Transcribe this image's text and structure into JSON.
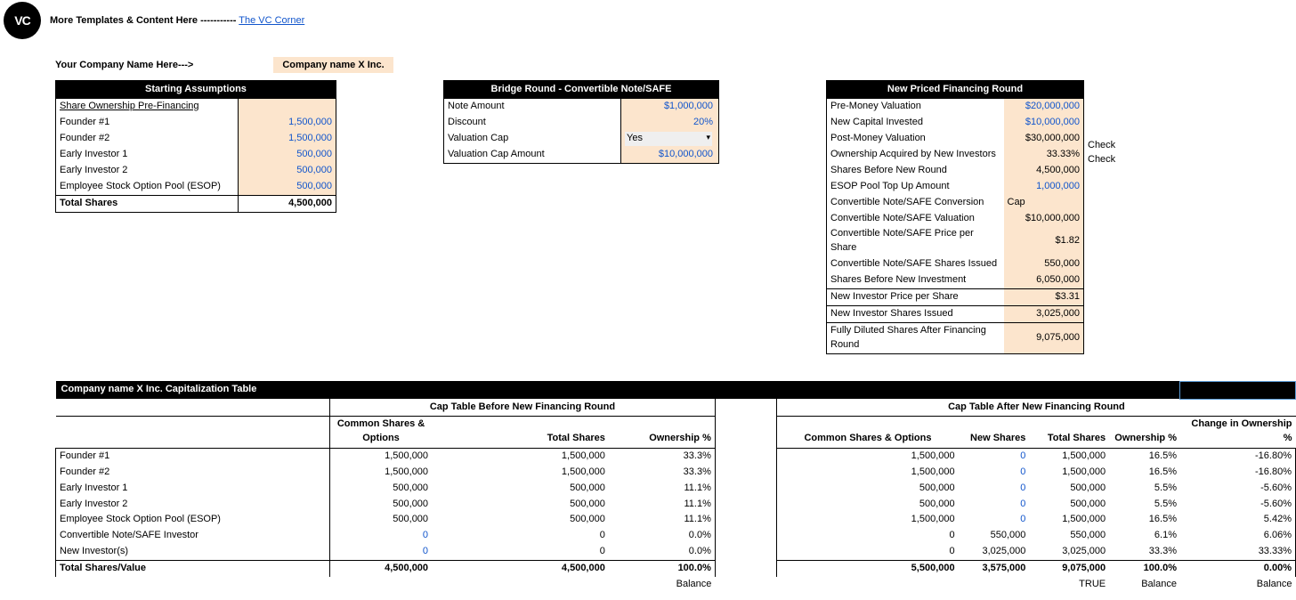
{
  "header": {
    "more_text": "More Templates & Content Here -----------",
    "link_text": "The VC Corner",
    "your_company_label": "Your Company Name Here--->",
    "company_name": "Company name X Inc."
  },
  "start": {
    "title": "Starting Assumptions",
    "pre_label": "Share Ownership Pre-Financing",
    "rows": [
      {
        "label": "Founder #1",
        "value": "1,500,000"
      },
      {
        "label": "Founder #2",
        "value": "1,500,000"
      },
      {
        "label": "Early Investor 1",
        "value": "500,000"
      },
      {
        "label": "Early Investor 2",
        "value": "500,000"
      },
      {
        "label": "Employee Stock Option Pool (ESOP)",
        "value": "500,000"
      }
    ],
    "total_label": "Total Shares",
    "total_value": "4,500,000"
  },
  "bridge": {
    "title": "Bridge Round - Convertible Note/SAFE",
    "rows": [
      {
        "label": "Note Amount",
        "value": "$1,000,000",
        "blue": true
      },
      {
        "label": "Discount",
        "value": "20%",
        "blue": true
      },
      {
        "label": "Valuation Cap",
        "value": "Yes",
        "dropdown": true
      },
      {
        "label": "Valuation Cap Amount",
        "value": "$10,000,000",
        "blue": true
      }
    ]
  },
  "priced": {
    "title": "New Priced Financing Round",
    "rows": [
      {
        "label": "Pre-Money Valuation",
        "value": "$20,000,000",
        "blue": true,
        "sep": false
      },
      {
        "label": "New Capital Invested",
        "value": "$10,000,000",
        "blue": true
      },
      {
        "label": "Post-Money Valuation",
        "value": "$30,000,000"
      },
      {
        "label": "Ownership Acquired by New Investors",
        "value": "33.33%",
        "check": "Check"
      },
      {
        "label": "Shares Before New Round",
        "value": "4,500,000",
        "check": "Check"
      },
      {
        "label": "ESOP Pool Top Up Amount",
        "value": "1,000,000",
        "blue": true
      },
      {
        "label": "Convertible Note/SAFE Conversion",
        "value": "Cap",
        "left": true
      },
      {
        "label": "Convertible Note/SAFE Valuation",
        "value": "$10,000,000"
      },
      {
        "label": "Convertible Note/SAFE Price per Share",
        "value": "$1.82"
      },
      {
        "label": "Convertible Note/SAFE Shares Issued",
        "value": "550,000"
      },
      {
        "label": "Shares Before New Investment",
        "value": "6,050,000"
      },
      {
        "label": "New Investor Price per Share",
        "value": "$3.31",
        "sepTop": true
      },
      {
        "label": "New Investor Shares Issued",
        "value": "3,025,000",
        "sepTop": true
      },
      {
        "label": "Fully Diluted Shares After Financing Round",
        "value": "9,075,000",
        "sepTop": true
      }
    ]
  },
  "cap": {
    "title": "Company name X Inc. Capitalization Table",
    "before_hdr": "Cap Table Before New Financing Round",
    "after_hdr": "Cap Table After New Financing Round",
    "col_before": [
      "Common Shares & Options",
      "Total Shares",
      "Ownership %"
    ],
    "col_after": [
      "Common Shares & Options",
      "New Shares",
      "Total Shares",
      "Ownership %",
      "Change in Ownership %"
    ],
    "rows": [
      {
        "name": "Founder #1",
        "b": [
          "1,500,000",
          "1,500,000",
          "33.3%"
        ],
        "a": [
          "1,500,000",
          "0",
          "1,500,000",
          "16.5%",
          "-16.80%"
        ],
        "blueNew": true
      },
      {
        "name": "Founder #2",
        "b": [
          "1,500,000",
          "1,500,000",
          "33.3%"
        ],
        "a": [
          "1,500,000",
          "0",
          "1,500,000",
          "16.5%",
          "-16.80%"
        ],
        "blueNew": true
      },
      {
        "name": "Early Investor 1",
        "b": [
          "500,000",
          "500,000",
          "11.1%"
        ],
        "a": [
          "500,000",
          "0",
          "500,000",
          "5.5%",
          "-5.60%"
        ],
        "blueNew": true
      },
      {
        "name": "Early Investor 2",
        "b": [
          "500,000",
          "500,000",
          "11.1%"
        ],
        "a": [
          "500,000",
          "0",
          "500,000",
          "5.5%",
          "-5.60%"
        ],
        "blueNew": true
      },
      {
        "name": "Employee Stock Option Pool (ESOP)",
        "b": [
          "500,000",
          "500,000",
          "11.1%"
        ],
        "a": [
          "1,500,000",
          "0",
          "1,500,000",
          "16.5%",
          "5.42%"
        ],
        "blueNew": true
      },
      {
        "name": "Convertible Note/SAFE Investor",
        "b": [
          "0",
          "0",
          "0.0%"
        ],
        "a": [
          "0",
          "550,000",
          "550,000",
          "6.1%",
          "6.06%"
        ],
        "blueFirst": true
      },
      {
        "name": "New Investor(s)",
        "b": [
          "0",
          "0",
          "0.0%"
        ],
        "a": [
          "0",
          "3,025,000",
          "3,025,000",
          "33.3%",
          "33.33%"
        ],
        "blueFirst": true
      }
    ],
    "total": {
      "name": "Total Shares/Value",
      "b": [
        "4,500,000",
        "4,500,000",
        "100.0%"
      ],
      "a": [
        "5,500,000",
        "3,575,000",
        "9,075,000",
        "100.0%",
        "0.00%"
      ]
    },
    "balance": {
      "b": [
        "",
        "",
        "Balance"
      ],
      "a": [
        "",
        "",
        "TRUE",
        "Balance",
        "Balance"
      ]
    }
  }
}
